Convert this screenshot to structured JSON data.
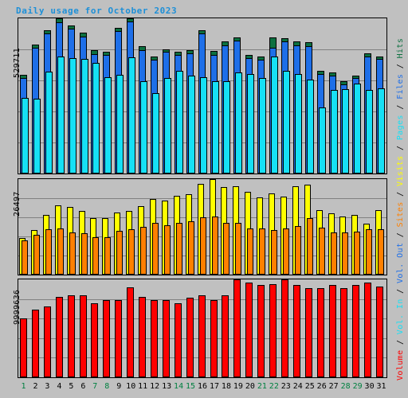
{
  "title": "Daily usage for October 2023",
  "axis": {
    "hits_max_label": "529711",
    "visits_max_label": "26497",
    "volume_max_label": "9999636"
  },
  "legend": {
    "volume": "Volume",
    "vol_in": "Vol. In",
    "vol_out": "Vol. Out",
    "sites": "Sites",
    "visits": "Visits",
    "pages": "Pages",
    "files": "Files",
    "hits": "Hits",
    "separator": " / "
  },
  "colors": {
    "hits": "#0C7040",
    "files": "#1E6FE8",
    "pages": "#16E0F5",
    "sites": "#FFFF00",
    "visits": "#FF8000",
    "volume": "#FF0000",
    "title": "#1E90D8",
    "weekend_label": "#008040",
    "weekday_label": "#000000",
    "background": "#C0C0C0",
    "gridline": "#808080"
  },
  "chart_data": {
    "type": "bar",
    "title": "Daily usage for October 2023",
    "xlabel": "",
    "ylabel": "Volume / Vol. In / Vol. Out / Sites / Visits / Pages / Files / Hits",
    "grid": true,
    "legend_position": "right-rotated",
    "categories": [
      1,
      2,
      3,
      4,
      5,
      6,
      7,
      8,
      9,
      10,
      11,
      12,
      13,
      14,
      15,
      16,
      17,
      18,
      19,
      20,
      21,
      22,
      23,
      24,
      25,
      26,
      27,
      28,
      29,
      30,
      31
    ],
    "weekend_days": [
      1,
      7,
      8,
      14,
      15,
      21,
      22,
      28,
      29
    ],
    "panels": [
      {
        "name": "hits-files-pages",
        "ylim": [
          0,
          529711
        ],
        "ymax_label": "529711",
        "gridlines": 4,
        "series": [
          {
            "name": "Hits",
            "color": "#0C7040",
            "values": [
              338000,
              440000,
              490000,
              529711,
              505000,
              480000,
              420000,
              415000,
              498000,
              529711,
              435000,
              400000,
              425000,
              415000,
              420000,
              490000,
              418000,
              450000,
              465000,
              405000,
              400000,
              465000,
              462000,
              450000,
              447000,
              350000,
              345000,
              315000,
              335000,
              410000,
              400000
            ]
          },
          {
            "name": "Files",
            "color": "#1E6FE8",
            "values": [
              325000,
              430000,
              478000,
              515000,
              495000,
              468000,
              408000,
              405000,
              487000,
              518000,
              420000,
              388000,
              415000,
              405000,
              410000,
              478000,
              405000,
              438000,
              455000,
              395000,
              388000,
              430000,
              450000,
              438000,
              435000,
              340000,
              335000,
              305000,
              325000,
              400000,
              390000
            ]
          },
          {
            "name": "Pages",
            "color": "#16E0F5",
            "values": [
              258000,
              255000,
              348000,
              400000,
              395000,
              392000,
              378000,
              330000,
              338000,
              397000,
              315000,
              275000,
              325000,
              350000,
              335000,
              330000,
              315000,
              315000,
              345000,
              340000,
              325000,
              400000,
              350000,
              340000,
              320000,
              225000,
              285000,
              288000,
              308000,
              285000,
              290000
            ]
          }
        ]
      },
      {
        "name": "sites-visits",
        "ylim": [
          0,
          26497
        ],
        "ymax_label": "26497",
        "gridlines": 4,
        "series": [
          {
            "name": "Sites",
            "color": "#FFFF00",
            "values": [
              10100,
              12400,
              16600,
              19300,
              18700,
              17700,
              15700,
              15700,
              17200,
              17700,
              18900,
              21000,
              20600,
              21800,
              22400,
              25100,
              26497,
              24300,
              24500,
              22900,
              21500,
              22600,
              21700,
              24600,
              24900,
              17900,
              16900,
              16200,
              16500,
              14200,
              17800
            ]
          },
          {
            "name": "Visits",
            "color": "#FF8000",
            "values": [
              9500,
              11000,
              12600,
              12700,
              11700,
              11400,
              10300,
              10400,
              12100,
              12500,
              13200,
              14400,
              13700,
              14300,
              14700,
              15900,
              16100,
              14400,
              14400,
              12900,
              12700,
              12400,
              12800,
              13500,
              15700,
              13000,
              11600,
              11800,
              11900,
              12500,
              12600
            ]
          }
        ]
      },
      {
        "name": "volume",
        "ylim": [
          0,
          9999636
        ],
        "ymax_label": "9999636",
        "gridlines": 4,
        "series": [
          {
            "name": "Volume",
            "color": "#FF0000",
            "values": [
              6050000,
              6950000,
              7250000,
              8250000,
              8400000,
              8350000,
              7600000,
              7900000,
              7900000,
              9150000,
              8200000,
              7900000,
              7900000,
              7550000,
              8150000,
              8350000,
              7850000,
              8350000,
              9999636,
              9650000,
              9450000,
              9550000,
              9999636,
              9450000,
              9100000,
              9100000,
              9450000,
              9100000,
              9450000,
              9700000,
              9250000
            ]
          }
        ]
      }
    ]
  }
}
